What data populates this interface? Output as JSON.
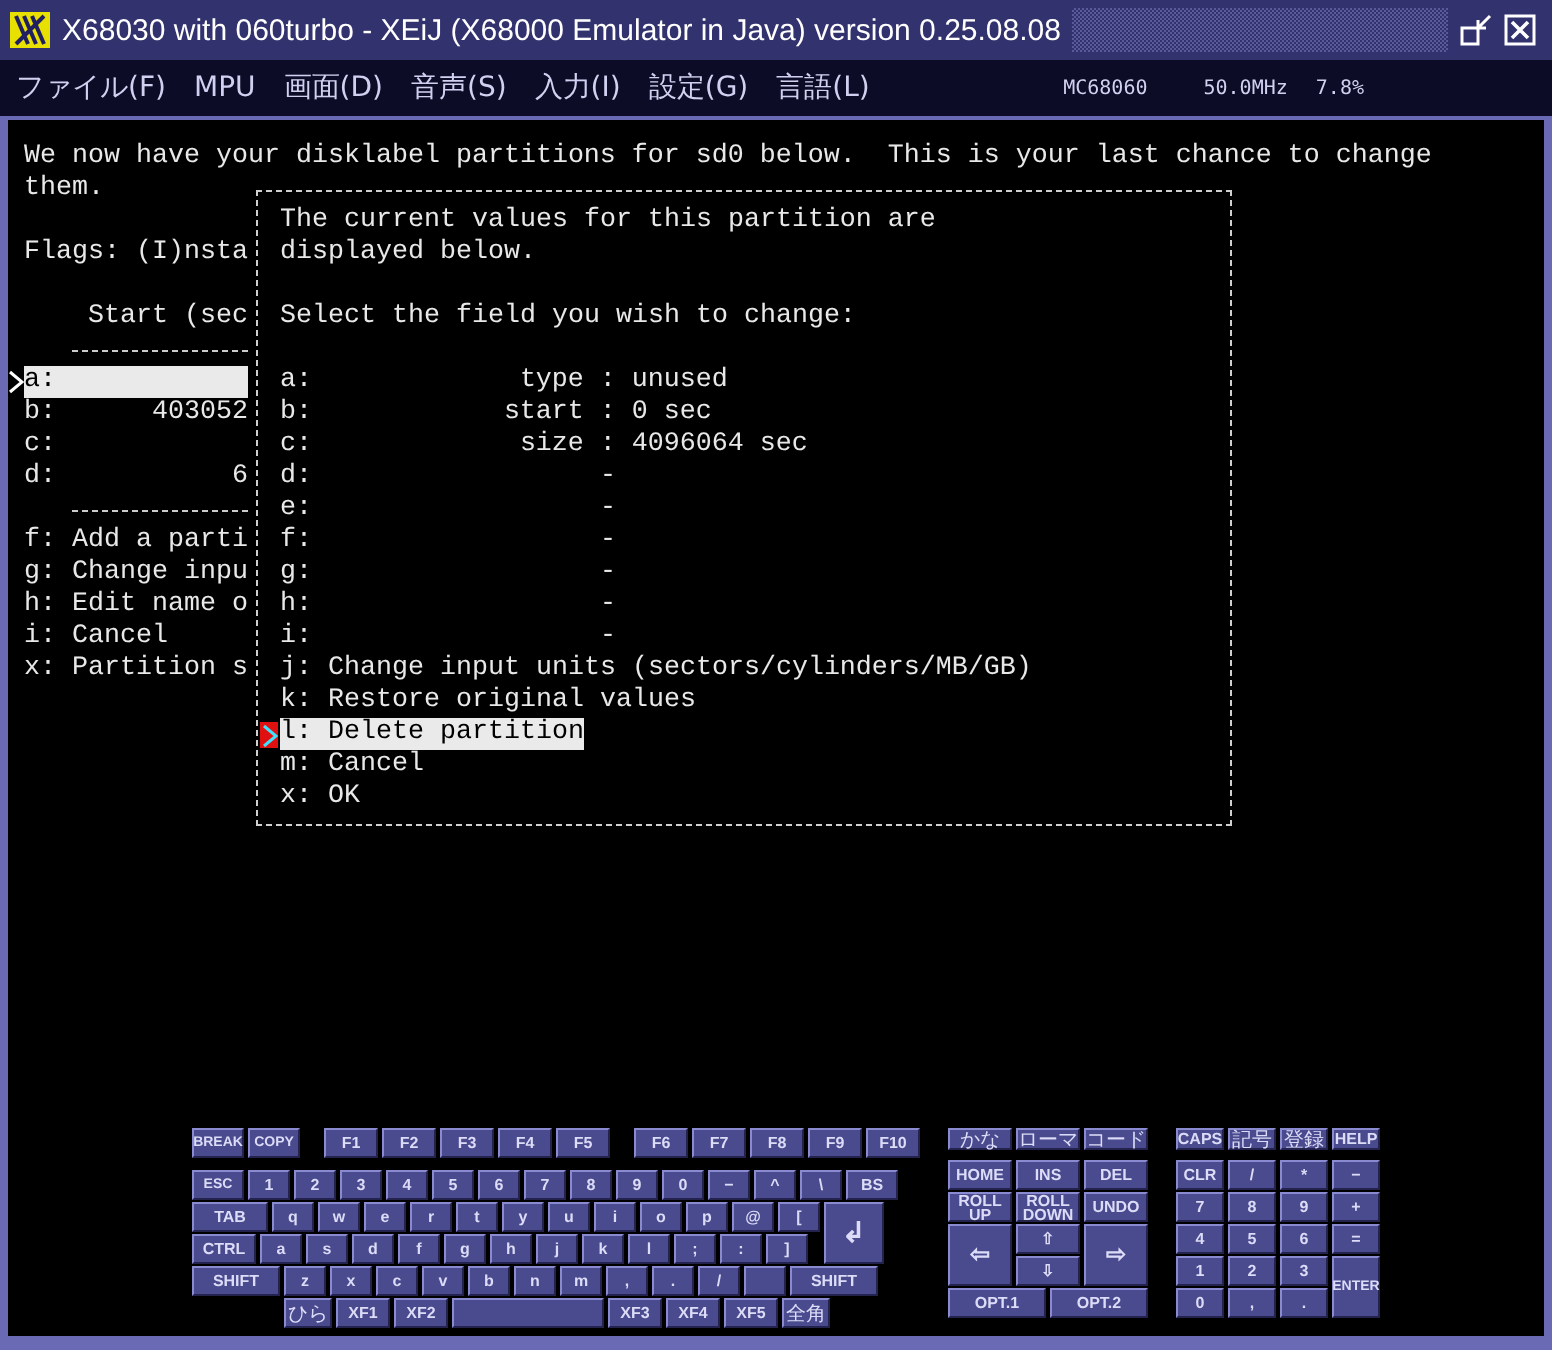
{
  "window": {
    "title": "X68030 with 060turbo - XEiJ (X68000 Emulator in Java) version 0.25.08.08"
  },
  "menu": [
    "ファイル(F)",
    "MPU",
    "画面(D)",
    "音声(S)",
    "入力(I)",
    "設定(G)",
    "言語(L)"
  ],
  "status": {
    "cpu": "MC68060",
    "clock": "50.0MHz",
    "load": "7.8%"
  },
  "terminal": {
    "intro": "We now have your disklabel partitions for sd0 below.  This is your last chance to change them.",
    "flags": "Flags: (I)nsta",
    "header": "Start (sec",
    "partitions": [
      {
        "key": "a:",
        "selected": true
      },
      {
        "key": "b:",
        "start": "403052",
        "selected": false
      },
      {
        "key": "c:",
        "selected": false
      },
      {
        "key": "d:",
        "start": "6",
        "selected": false
      }
    ],
    "commands": [
      "f: Add a parti",
      "g: Change inpu",
      "h: Edit name o",
      "i: Cancel",
      "x: Partition s"
    ]
  },
  "dialog": {
    "intro": "The current values for this partition are\ndisplayed below.",
    "prompt": "Select the field you wish to change:",
    "fields": [
      {
        "key": "a:",
        "kind": "set",
        "name": "type :",
        "value": "unused"
      },
      {
        "key": "b:",
        "kind": "set",
        "name": "start :",
        "value": "0 sec"
      },
      {
        "key": "c:",
        "kind": "set",
        "name": "size :",
        "value": "4096064 sec"
      },
      {
        "key": "d:",
        "kind": "empty",
        "value": "-"
      },
      {
        "key": "e:",
        "kind": "empty",
        "value": "-"
      },
      {
        "key": "f:",
        "kind": "empty",
        "value": "-"
      },
      {
        "key": "g:",
        "kind": "empty",
        "value": "-"
      },
      {
        "key": "h:",
        "kind": "empty",
        "value": "-"
      },
      {
        "key": "i:",
        "kind": "empty",
        "value": "-"
      }
    ],
    "actions": [
      {
        "label": "j: Change input units (sectors/cylinders/MB/GB)",
        "selected": false
      },
      {
        "label": "k: Restore original values",
        "selected": false
      },
      {
        "label": "l: Delete partition",
        "selected": true
      },
      {
        "label": "m: Cancel",
        "selected": false
      },
      {
        "label": "x: OK",
        "selected": false
      }
    ]
  },
  "keyboard": {
    "main": [
      [
        {
          "label": "BREAK",
          "kind": "sys"
        },
        {
          "label": "COPY",
          "kind": "sys"
        },
        {
          "label": "F1",
          "kind": "fn-first"
        },
        {
          "label": "F2",
          "kind": "fn"
        },
        {
          "label": "F3",
          "kind": "fn"
        },
        {
          "label": "F4",
          "kind": "fn"
        },
        {
          "label": "F5",
          "kind": "fn"
        },
        {
          "label": "F6",
          "kind": "fn-first"
        },
        {
          "label": "F7",
          "kind": "fn"
        },
        {
          "label": "F8",
          "kind": "fn"
        },
        {
          "label": "F9",
          "kind": "fn"
        },
        {
          "label": "F10",
          "kind": "fn"
        }
      ],
      [
        {
          "label": "ESC",
          "kind": "sys"
        },
        {
          "label": "1",
          "kind": "key"
        },
        {
          "label": "2",
          "kind": "key"
        },
        {
          "label": "3",
          "kind": "key"
        },
        {
          "label": "4",
          "kind": "key"
        },
        {
          "label": "5",
          "kind": "key"
        },
        {
          "label": "6",
          "kind": "key"
        },
        {
          "label": "7",
          "kind": "key"
        },
        {
          "label": "8",
          "kind": "key"
        },
        {
          "label": "9",
          "kind": "key"
        },
        {
          "label": "0",
          "kind": "key"
        },
        {
          "label": "−",
          "kind": "key"
        },
        {
          "label": "^",
          "kind": "key"
        },
        {
          "label": "\\",
          "kind": "key"
        },
        {
          "label": "BS",
          "kind": "bs"
        }
      ],
      [
        {
          "label": "TAB",
          "kind": "tab"
        },
        {
          "label": "q",
          "kind": "key"
        },
        {
          "label": "w",
          "kind": "key"
        },
        {
          "label": "e",
          "kind": "key"
        },
        {
          "label": "r",
          "kind": "key"
        },
        {
          "label": "t",
          "kind": "key"
        },
        {
          "label": "y",
          "kind": "key"
        },
        {
          "label": "u",
          "kind": "key"
        },
        {
          "label": "i",
          "kind": "key"
        },
        {
          "label": "o",
          "kind": "key"
        },
        {
          "label": "p",
          "kind": "key"
        },
        {
          "label": "@",
          "kind": "key"
        },
        {
          "label": "[",
          "kind": "key"
        },
        {
          "label": "↲",
          "kind": "enter"
        }
      ],
      [
        {
          "label": "CTRL",
          "kind": "ctrl"
        },
        {
          "label": "a",
          "kind": "key"
        },
        {
          "label": "s",
          "kind": "key"
        },
        {
          "label": "d",
          "kind": "key"
        },
        {
          "label": "f",
          "kind": "key"
        },
        {
          "label": "g",
          "kind": "key"
        },
        {
          "label": "h",
          "kind": "key"
        },
        {
          "label": "j",
          "kind": "key"
        },
        {
          "label": "k",
          "kind": "key"
        },
        {
          "label": "l",
          "kind": "key"
        },
        {
          "label": ";",
          "kind": "key"
        },
        {
          "label": ":",
          "kind": "key"
        },
        {
          "label": "]",
          "kind": "key"
        }
      ],
      [
        {
          "label": "SHIFT",
          "kind": "shift"
        },
        {
          "label": "z",
          "kind": "key"
        },
        {
          "label": "x",
          "kind": "key"
        },
        {
          "label": "c",
          "kind": "key"
        },
        {
          "label": "v",
          "kind": "key"
        },
        {
          "label": "b",
          "kind": "key"
        },
        {
          "label": "n",
          "kind": "key"
        },
        {
          "label": "m",
          "kind": "key"
        },
        {
          "label": ",",
          "kind": "key"
        },
        {
          "label": ".",
          "kind": "key"
        },
        {
          "label": "/",
          "kind": "key"
        },
        {
          "kind": "blank"
        },
        {
          "label": "SHIFT",
          "kind": "shift"
        }
      ],
      [
        {
          "label": "ひら",
          "kind": "jp"
        },
        {
          "label": "XF1",
          "kind": "xf"
        },
        {
          "label": "XF2",
          "kind": "xf"
        },
        {
          "kind": "space"
        },
        {
          "label": "XF3",
          "kind": "xf"
        },
        {
          "label": "XF4",
          "kind": "xf"
        },
        {
          "label": "XF5",
          "kind": "xf"
        },
        {
          "label": "全角",
          "kind": "jp"
        }
      ]
    ],
    "middle": [
      {
        "label": "かな",
        "kind": "jp"
      },
      {
        "label": "ローマ",
        "kind": "jp"
      },
      {
        "label": "コード",
        "kind": "jp"
      },
      {
        "label": "HOME",
        "kind": "key"
      },
      {
        "label": "INS",
        "kind": "key"
      },
      {
        "label": "DEL",
        "kind": "key"
      },
      {
        "label": "ROLL UP",
        "kind": "key"
      },
      {
        "label": "ROLL DOWN",
        "kind": "key"
      },
      {
        "label": "UNDO",
        "kind": "key"
      },
      {
        "label": "⇦",
        "kind": "tall"
      },
      {
        "label": "⇧",
        "kind": "key"
      },
      {
        "label": "⇨",
        "kind": "tall"
      },
      {
        "label": "⇩",
        "kind": "key"
      },
      {
        "label": "OPT.1",
        "kind": "wide"
      },
      {
        "label": "OPT.2",
        "kind": "wide"
      }
    ],
    "numpad": [
      {
        "label": "CAPS",
        "kind": "key"
      },
      {
        "label": "記号",
        "kind": "jp"
      },
      {
        "label": "登録",
        "kind": "jp"
      },
      {
        "label": "HELP",
        "kind": "key"
      },
      {
        "label": "CLR",
        "kind": "key"
      },
      {
        "label": "/",
        "kind": "key"
      },
      {
        "label": "*",
        "kind": "key"
      },
      {
        "label": "−",
        "kind": "key"
      },
      {
        "label": "7",
        "kind": "key"
      },
      {
        "label": "8",
        "kind": "key"
      },
      {
        "label": "9",
        "kind": "key"
      },
      {
        "label": "+",
        "kind": "key"
      },
      {
        "label": "4",
        "kind": "key"
      },
      {
        "label": "5",
        "kind": "key"
      },
      {
        "label": "6",
        "kind": "key"
      },
      {
        "label": "=",
        "kind": "key"
      },
      {
        "label": "1",
        "kind": "key"
      },
      {
        "label": "2",
        "kind": "key"
      },
      {
        "label": "3",
        "kind": "key"
      },
      {
        "label": "ENTER",
        "kind": "tall"
      },
      {
        "label": "0",
        "kind": "key"
      },
      {
        "label": ",",
        "kind": "key"
      },
      {
        "label": ".",
        "kind": "key"
      }
    ]
  }
}
